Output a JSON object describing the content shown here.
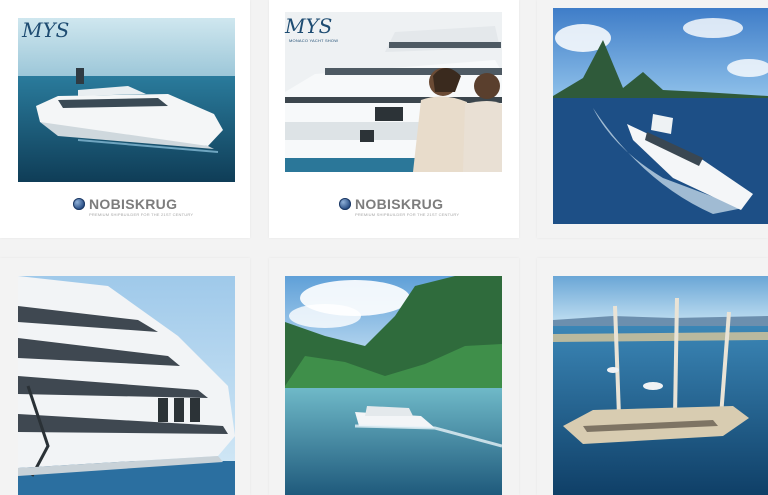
{
  "grid": {
    "posts": [
      {
        "caption_brand": "NOBISKRUG",
        "caption_tagline": "PREMIUM SHIPBUILDER FOR THE 21ST CENTURY",
        "logo": "MYS",
        "logo_sub": ""
      },
      {
        "caption_brand": "NOBISKRUG",
        "caption_tagline": "PREMIUM SHIPBUILDER FOR THE 21ST CENTURY",
        "logo": "MYS",
        "logo_sub": "MONACO YACHT SHOW"
      },
      {
        "caption_brand": "",
        "caption_tagline": "",
        "logo": "",
        "logo_sub": ""
      },
      {
        "caption_brand": "",
        "caption_tagline": "",
        "logo": "",
        "logo_sub": ""
      },
      {
        "caption_brand": "",
        "caption_tagline": "",
        "logo": "",
        "logo_sub": ""
      },
      {
        "caption_brand": "",
        "caption_tagline": "",
        "logo": "",
        "logo_sub": ""
      }
    ]
  },
  "colors": {
    "background": "#f3f3f3",
    "tile": "#ffffff",
    "brand_gray": "#7d7d7d",
    "mys_blue": "#1e4c72"
  },
  "icons": [
    "nobiskrug-globe-icon"
  ]
}
